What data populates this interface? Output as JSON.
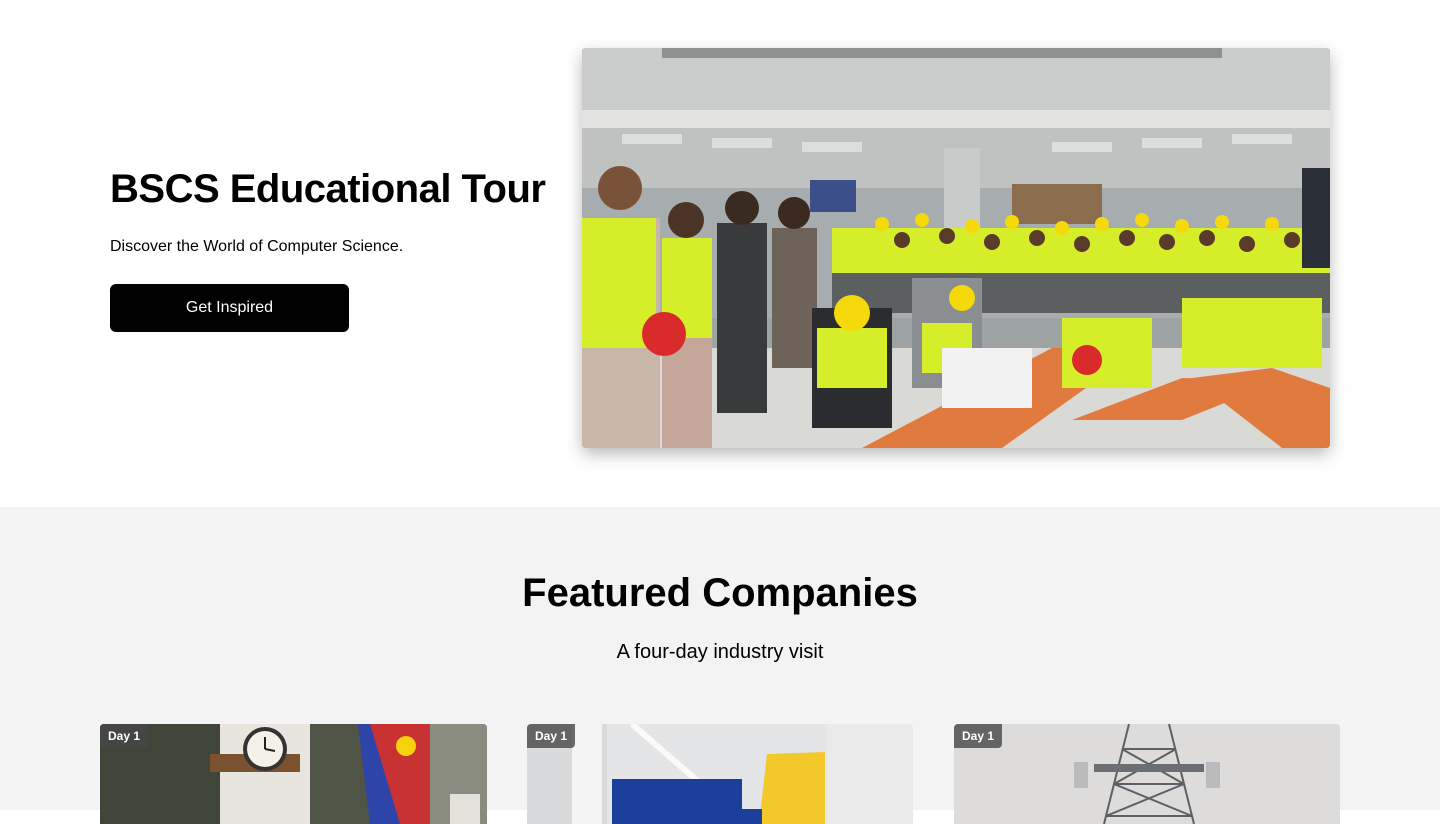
{
  "hero": {
    "title": "BSCS Educational Tour",
    "subtitle": "Discover the World of Computer Science.",
    "cta_label": "Get Inspired",
    "photo_icon": "group-photo-image"
  },
  "featured": {
    "title": "Featured Companies",
    "subtitle": "A four-day industry visit",
    "cards": [
      {
        "badge": "Day 1",
        "photo_icon": "office-flag-clock-image"
      },
      {
        "badge": "Day 1",
        "photo_icon": "office-interior-image"
      },
      {
        "badge": "Day 1",
        "photo_icon": "cell-tower-image"
      }
    ]
  },
  "colors": {
    "background": "#ffffff",
    "section_background": "#f3f3f3",
    "button": "#000000",
    "button_text": "#ffffff",
    "safety_vest": "#d6ee2a",
    "hard_hat": "#f5d90a",
    "floor_accent": "#e07a3e"
  }
}
